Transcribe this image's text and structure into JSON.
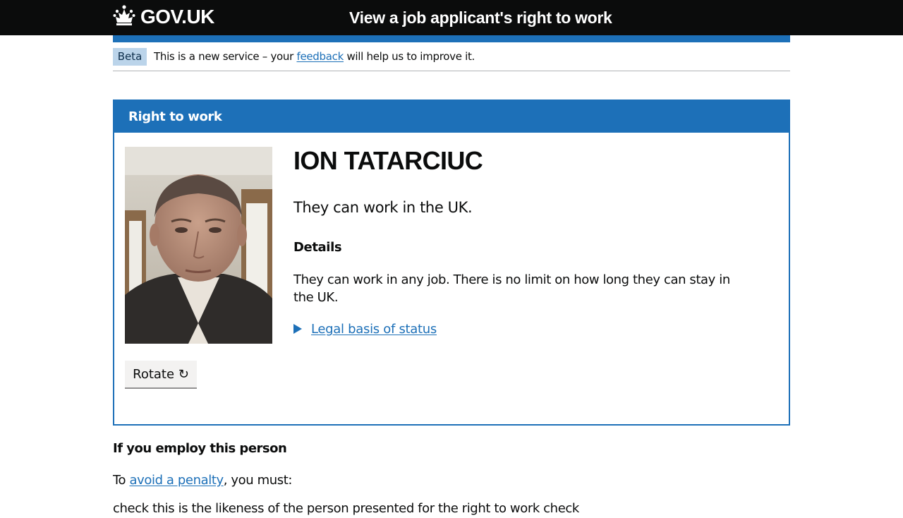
{
  "header": {
    "logo_text": "GOV.UK",
    "service_name": "View a job applicant's right to work"
  },
  "phase_banner": {
    "tag": "Beta",
    "text_before": "This is a new service – your ",
    "link_text": "feedback",
    "text_after": " will help us to improve it."
  },
  "panel": {
    "title": "Right to work",
    "photo_icon": "applicant-photo",
    "rotate_label": "Rotate ↻",
    "name": "ION TATARCIUC",
    "status": "They can work in the UK.",
    "details_heading": "Details",
    "details_text": "They can work in any job. There is no limit on how long they can stay in the UK.",
    "legal_link": "Legal basis of status"
  },
  "employ": {
    "heading": "If you employ this person",
    "text_before": "To ",
    "link_text": "avoid a penalty",
    "text_after": ", you must:",
    "next_line": "check this is the likeness of the person presented for the right to work check"
  },
  "colors": {
    "header_bg": "#0b0c0c",
    "brand_blue": "#1d70b8",
    "tag_bg": "#bbd4ea",
    "button_bg": "#f3f2f1"
  }
}
